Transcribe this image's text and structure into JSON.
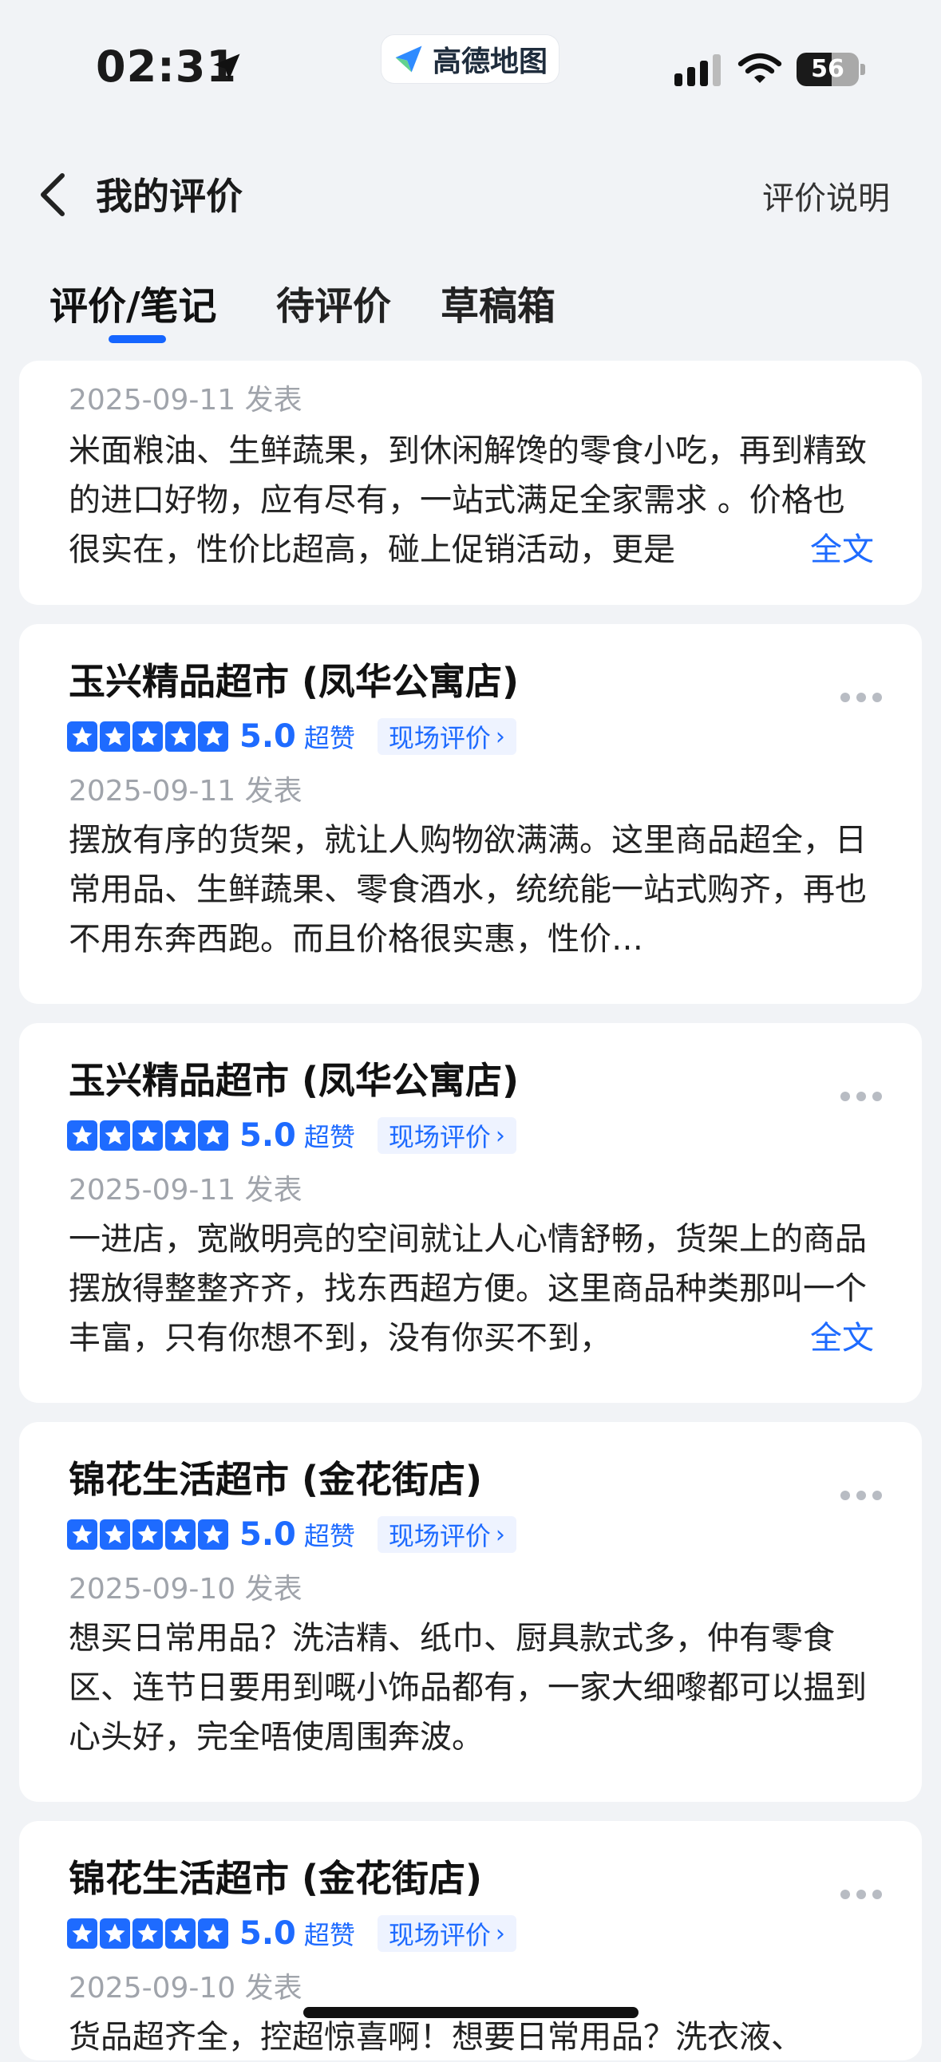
{
  "status": {
    "time": "02:31",
    "app_name": "高德地图",
    "battery": "56",
    "battery_level": 0.56
  },
  "header": {
    "title": "我的评价",
    "help": "评价说明"
  },
  "tabs": [
    {
      "label": "评价/笔记",
      "active": true
    },
    {
      "label": "待评价",
      "active": false
    },
    {
      "label": "草稿箱",
      "active": false
    }
  ],
  "reviews": [
    {
      "date": "2025-09-11 发表",
      "text": "米面粮油、生鲜蔬果，到休闲解馋的零食小吃，再到精致的进口好物，应有尽有，一站式满足全家需求 。价格也很实在，性价比超高，碰上促销活动，更是",
      "fulltext": "全文"
    },
    {
      "shop": "玉兴精品超市 (凤华公寓店)",
      "score": "5.0",
      "praise": "超赞",
      "onsite": "现场评价",
      "date": "2025-09-11 发表",
      "text": "摆放有序的货架，就让人购物欲满满。这里商品超全，日常用品、生鲜蔬果、零食酒水，统统能一站式购齐，再也不用东奔西跑。而且价格很实惠，性价…"
    },
    {
      "shop": "玉兴精品超市 (凤华公寓店)",
      "score": "5.0",
      "praise": "超赞",
      "onsite": "现场评价",
      "date": "2025-09-11 发表",
      "text": "一进店，宽敞明亮的空间就让人心情舒畅，货架上的商品摆放得整整齐齐，找东西超方便。这里商品种类那叫一个丰富，只有你想不到，没有你买不到，",
      "fulltext": "全文"
    },
    {
      "shop": "锦花生活超市 (金花街店)",
      "score": "5.0",
      "praise": "超赞",
      "onsite": "现场评价",
      "date": "2025-09-10 发表",
      "text": "想买日常用品？洗洁精、纸巾、厨具款式多，仲有零食区、连节日要用到嘅小饰品都有，一家大细嚟都可以揾到心头好，完全唔使周围奔波。"
    },
    {
      "shop": "锦花生活超市 (金花街店)",
      "score": "5.0",
      "praise": "超赞",
      "onsite": "现场评价",
      "date": "2025-09-10 发表",
      "text": "货品超齐全，控超惊喜啊！想要日常用品？洗衣液、"
    }
  ]
}
